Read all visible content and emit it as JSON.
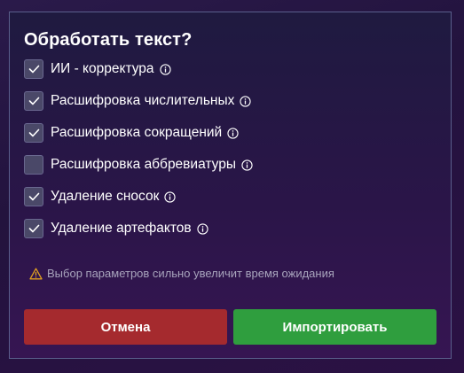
{
  "dialog": {
    "title": "Обработать текст?",
    "options": [
      {
        "label": "ИИ - корректура",
        "checked": true
      },
      {
        "label": "Расшифровка числительных",
        "checked": true
      },
      {
        "label": "Расшифровка сокращений",
        "checked": true
      },
      {
        "label": "Расшифровка аббревиатуры",
        "checked": false
      },
      {
        "label": "Удаление сносок",
        "checked": true
      },
      {
        "label": "Удаление артефактов",
        "checked": true
      }
    ],
    "warning": "Выбор параметров сильно увеличит время ожидания",
    "cancel_label": "Отмена",
    "import_label": "Импортировать"
  },
  "colors": {
    "cancel": "#a52a2e",
    "import": "#2f9e3e",
    "warning_icon": "#e0a020"
  },
  "icons": {
    "check": "check-icon",
    "info": "info-icon",
    "warning": "warning-icon"
  }
}
